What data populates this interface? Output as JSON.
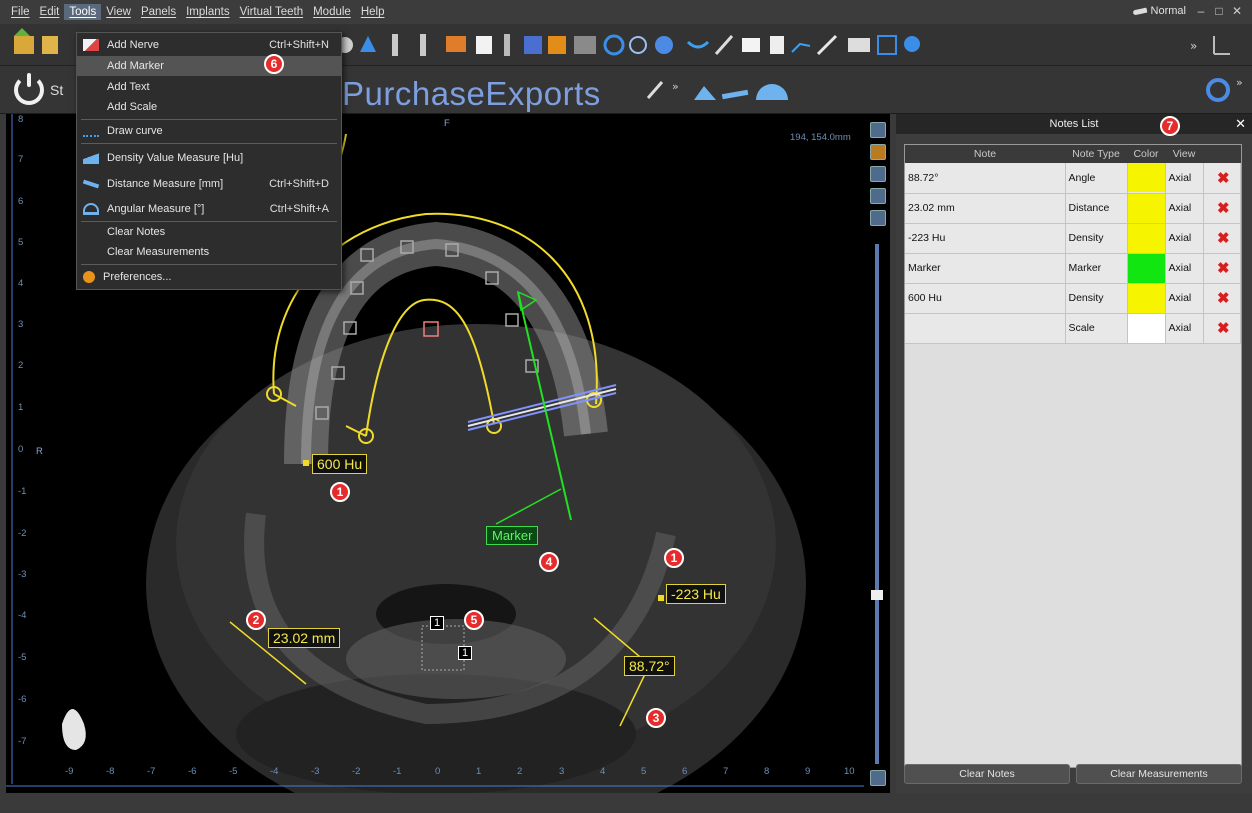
{
  "menubar": {
    "items": [
      "File",
      "Edit",
      "Tools",
      "View",
      "Panels",
      "Implants",
      "Virtual Teeth",
      "Module",
      "Help"
    ],
    "mode_label": "Normal"
  },
  "toolbar": {
    "session_label": "St",
    "brand_text": "PurchaseExports"
  },
  "tools_menu": {
    "items": [
      {
        "label": "Add Nerve",
        "shortcut": "Ctrl+Shift+N",
        "icon": "nerve-icon"
      },
      {
        "label": "Add Marker",
        "shortcut": "",
        "icon": ""
      },
      {
        "label": "Add Text",
        "shortcut": "",
        "icon": ""
      },
      {
        "label": "Add Scale",
        "shortcut": "",
        "icon": ""
      },
      {
        "label": "Draw curve",
        "shortcut": "",
        "icon": "curve-icon"
      },
      {
        "label": "Density Value Measure [Hu]",
        "shortcut": "",
        "icon": "density-icon"
      },
      {
        "label": "Distance Measure [mm]",
        "shortcut": "Ctrl+Shift+D",
        "icon": "distance-icon"
      },
      {
        "label": "Angular Measure [°]",
        "shortcut": "Ctrl+Shift+A",
        "icon": "angle-icon"
      },
      {
        "label": "Clear Notes",
        "shortcut": "",
        "icon": ""
      },
      {
        "label": "Clear Measurements",
        "shortcut": "",
        "icon": ""
      },
      {
        "label": "Preferences...",
        "shortcut": "",
        "icon": "gear-icon"
      }
    ]
  },
  "viewport": {
    "orientation_top": "F",
    "orientation_left": "R",
    "coords": "194, 154.0mm",
    "labels": {
      "density_600": "600 Hu",
      "density_223": "-223 Hu",
      "distance": "23.02 mm",
      "angle": "88.72°",
      "marker": "Marker",
      "scale_1a": "1",
      "scale_1b": "1"
    },
    "callouts": [
      "1",
      "2",
      "3",
      "4",
      "5",
      "1",
      "6",
      "7"
    ],
    "x_ticks": [
      "-9",
      "-8",
      "-7",
      "-6",
      "-5",
      "-4",
      "-3",
      "-2",
      "-1",
      "0",
      "1",
      "2",
      "3",
      "4",
      "5",
      "6",
      "7",
      "8",
      "9",
      "10"
    ],
    "y_ticks": [
      "8",
      "7",
      "6",
      "5",
      "4",
      "3",
      "2",
      "1",
      "0",
      "-1",
      "-2",
      "-3",
      "-4",
      "-5",
      "-6",
      "-7"
    ]
  },
  "notes_panel": {
    "title": "Notes List",
    "columns": [
      "Note",
      "Note Type",
      "Color",
      "View"
    ],
    "rows": [
      {
        "note": "88.72°",
        "type": "Angle",
        "color": "#f7f400",
        "view": "Axial"
      },
      {
        "note": "23.02 mm",
        "type": "Distance",
        "color": "#f7f400",
        "view": "Axial"
      },
      {
        "note": "-223 Hu",
        "type": "Density",
        "color": "#f7f400",
        "view": "Axial"
      },
      {
        "note": "Marker",
        "type": "Marker",
        "color": "#11e611",
        "view": "Axial"
      },
      {
        "note": "600 Hu",
        "type": "Density",
        "color": "#f7f400",
        "view": "Axial"
      },
      {
        "note": "",
        "type": "Scale",
        "color": "#ffffff",
        "view": "Axial"
      }
    ],
    "clear_notes": "Clear Notes",
    "clear_measurements": "Clear Measurements"
  }
}
